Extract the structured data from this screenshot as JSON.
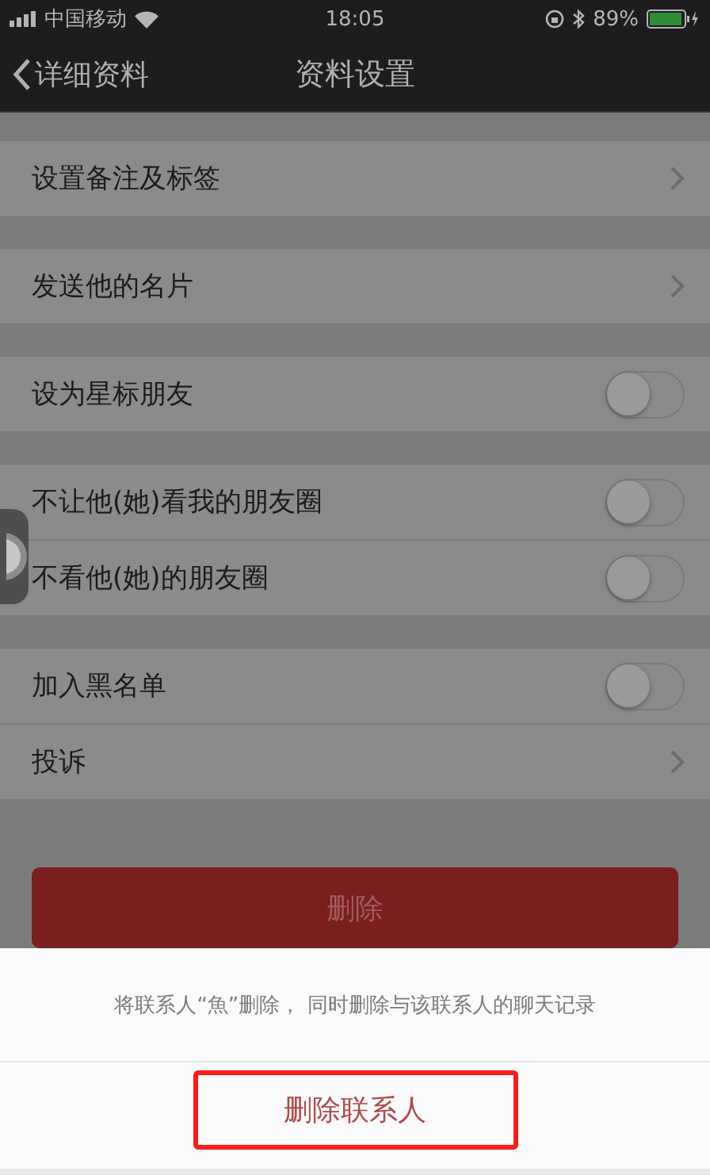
{
  "status_bar": {
    "carrier": "中国移动",
    "time": "18:05",
    "battery": "89%"
  },
  "nav": {
    "back": "详细资料",
    "title": "资料设置"
  },
  "groups": [
    {
      "rows": [
        {
          "kind": "link",
          "label": "设置备注及标签"
        }
      ]
    },
    {
      "rows": [
        {
          "kind": "link",
          "label": "发送他的名片"
        }
      ]
    },
    {
      "rows": [
        {
          "kind": "switch",
          "label": "设为星标朋友",
          "on": false
        }
      ]
    },
    {
      "rows": [
        {
          "kind": "switch",
          "label": "不让他(她)看我的朋友圈",
          "on": false
        },
        {
          "kind": "switch",
          "label": "不看他(她)的朋友圈",
          "on": false
        }
      ]
    },
    {
      "rows": [
        {
          "kind": "switch",
          "label": "加入黑名单",
          "on": false
        },
        {
          "kind": "link",
          "label": "投诉"
        }
      ]
    }
  ],
  "delete_button": "删除",
  "sheet": {
    "message": "将联系人“魚”删除， 同时删除与该联系人的聊天记录",
    "confirm": {
      "label": "删除联系人",
      "highlighted": true
    }
  }
}
